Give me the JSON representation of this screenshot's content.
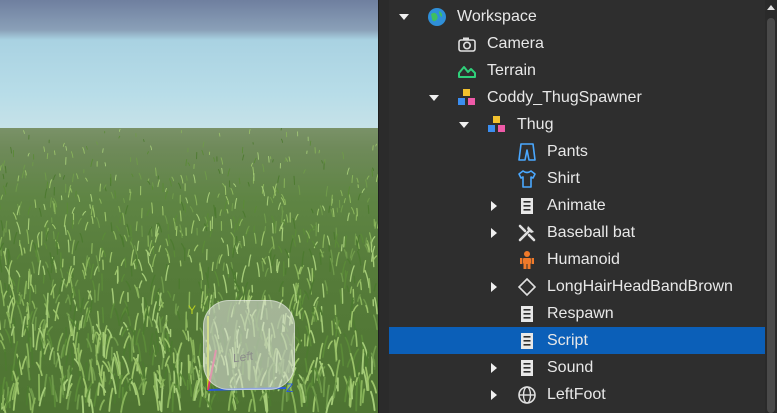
{
  "viewport": {
    "cube_face_label": "Left"
  },
  "explorer": {
    "items": [
      {
        "label": "Workspace",
        "icon": "globe-icon",
        "expanded": true,
        "has_arrow": true,
        "depth": 0
      },
      {
        "label": "Camera",
        "icon": "camera-icon",
        "has_arrow": false,
        "depth": 1
      },
      {
        "label": "Terrain",
        "icon": "terrain-icon",
        "has_arrow": false,
        "depth": 1
      },
      {
        "label": "Coddy_ThugSpawner",
        "icon": "model-icon",
        "expanded": true,
        "has_arrow": true,
        "depth": 1
      },
      {
        "label": "Thug",
        "icon": "model-icon",
        "expanded": true,
        "has_arrow": true,
        "depth": 2
      },
      {
        "label": "Pants",
        "icon": "pants-icon",
        "has_arrow": false,
        "depth": 3
      },
      {
        "label": "Shirt",
        "icon": "shirt-icon",
        "has_arrow": false,
        "depth": 3
      },
      {
        "label": "Animate",
        "icon": "script-icon",
        "expanded": false,
        "has_arrow": true,
        "depth": 3
      },
      {
        "label": "Baseball bat",
        "icon": "tool-icon",
        "expanded": false,
        "has_arrow": true,
        "depth": 3
      },
      {
        "label": "Humanoid",
        "icon": "humanoid-icon",
        "has_arrow": false,
        "depth": 3
      },
      {
        "label": "LongHairHeadBandBrown",
        "icon": "accessory-icon",
        "expanded": false,
        "has_arrow": true,
        "depth": 3
      },
      {
        "label": "Respawn",
        "icon": "script-icon",
        "has_arrow": false,
        "depth": 3
      },
      {
        "label": "Script",
        "icon": "script-icon",
        "has_arrow": false,
        "depth": 3,
        "selected": true
      },
      {
        "label": "Sound",
        "icon": "script-icon",
        "expanded": false,
        "has_arrow": true,
        "depth": 3
      },
      {
        "label": "LeftFoot",
        "icon": "mesh-icon",
        "expanded": false,
        "has_arrow": true,
        "depth": 3
      }
    ]
  },
  "colors": {
    "selection": "#0b5fb8",
    "panel_bg": "#2e2e2e",
    "text": "#e8e8e8"
  }
}
